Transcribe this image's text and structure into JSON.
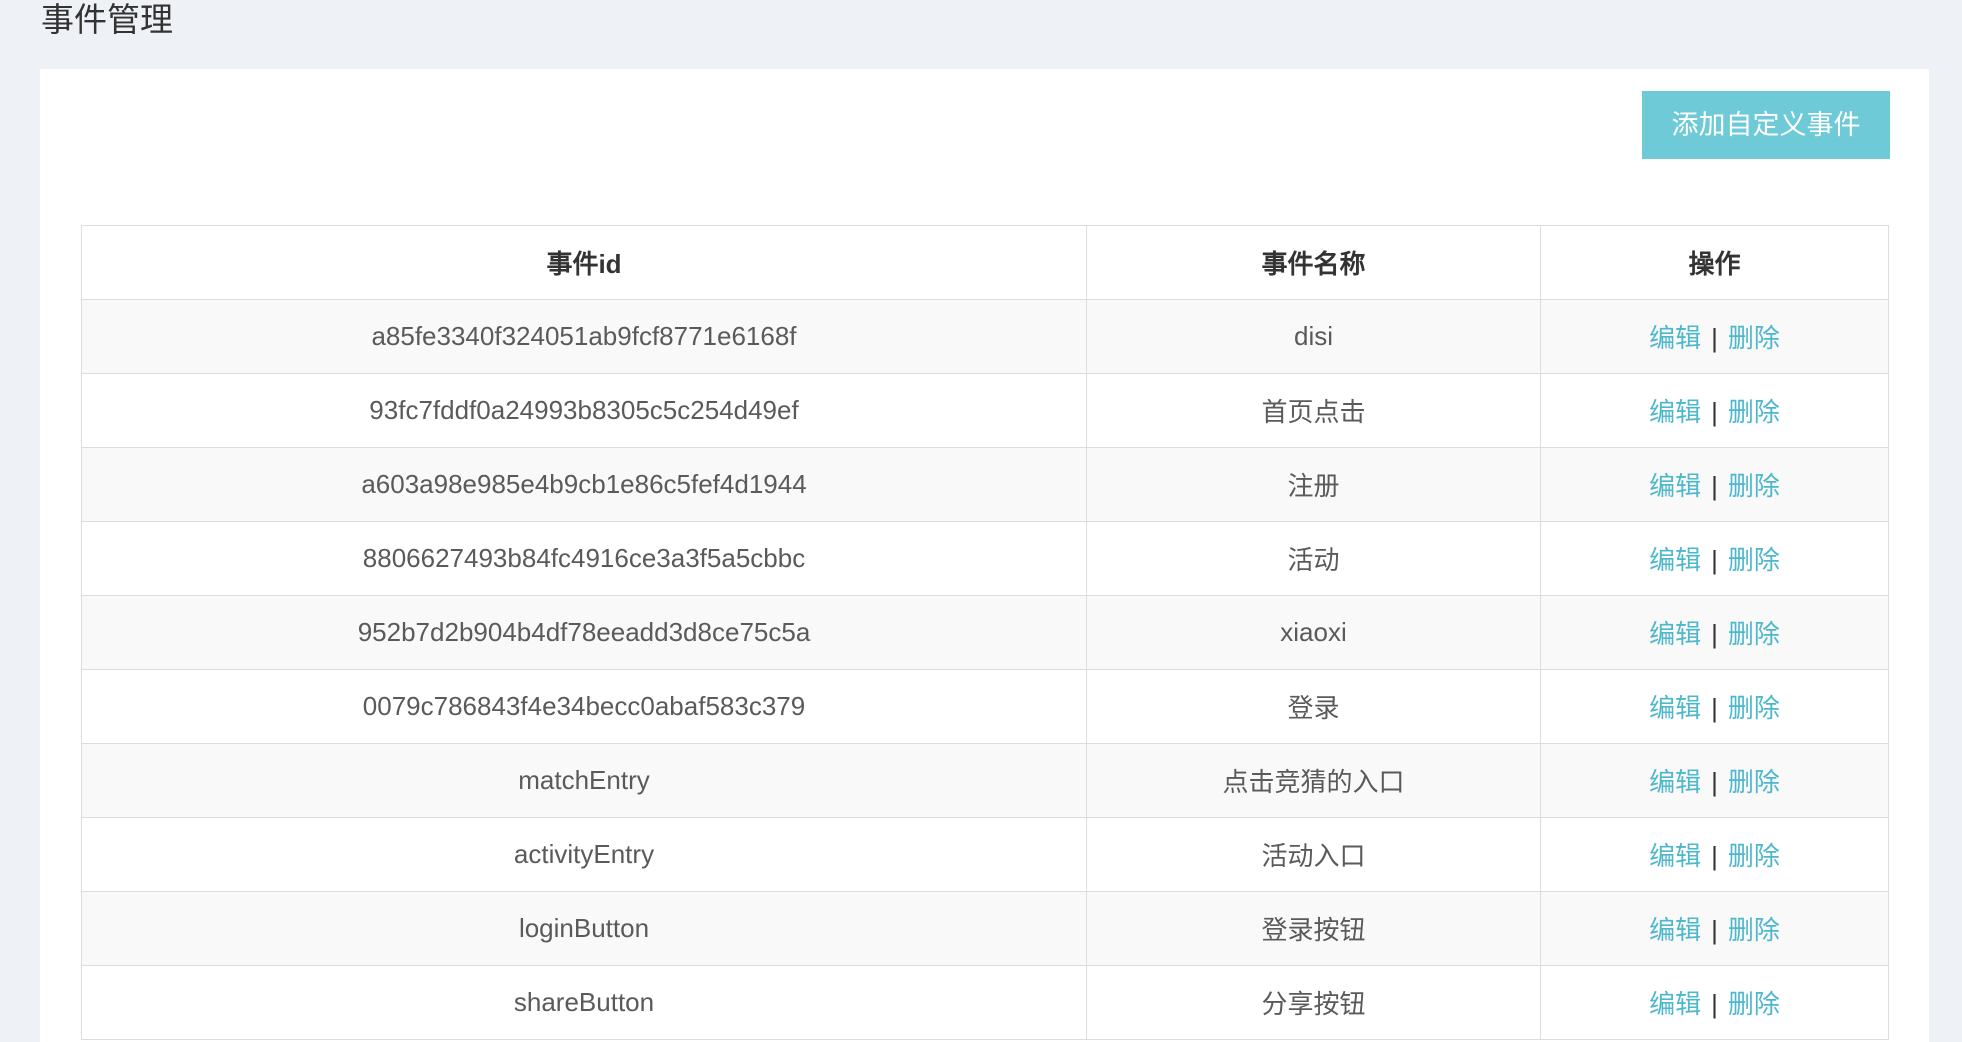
{
  "page": {
    "title": "事件管理"
  },
  "toolbar": {
    "add_label": "添加自定义事件"
  },
  "table": {
    "columns": [
      "事件id",
      "事件名称",
      "操作"
    ],
    "rows": [
      {
        "id": "a85fe3340f324051ab9fcf8771e6168f",
        "name": "disi"
      },
      {
        "id": "93fc7fddf0a24993b8305c5c254d49ef",
        "name": "首页点击"
      },
      {
        "id": "a603a98e985e4b9cb1e86c5fef4d1944",
        "name": "注册"
      },
      {
        "id": "8806627493b84fc4916ce3a3f5a5cbbc",
        "name": "活动"
      },
      {
        "id": "952b7d2b904b4df78eeadd3d8ce75c5a",
        "name": "xiaoxi"
      },
      {
        "id": "0079c786843f4e34becc0abaf583c379",
        "name": "登录"
      },
      {
        "id": "matchEntry",
        "name": "点击竞猜的入口"
      },
      {
        "id": "activityEntry",
        "name": "活动入口"
      },
      {
        "id": "loginButton",
        "name": "登录按钮"
      },
      {
        "id": "shareButton",
        "name": "分享按钮"
      }
    ],
    "actions": {
      "edit": "编辑",
      "separator": "|",
      "delete": "删除"
    }
  },
  "colors": {
    "page_background": "#eef1f6",
    "button_accent": "#6dcad6",
    "link": "#4db8cc",
    "stripe": "#f9f9f9",
    "border": "#dddddd"
  }
}
